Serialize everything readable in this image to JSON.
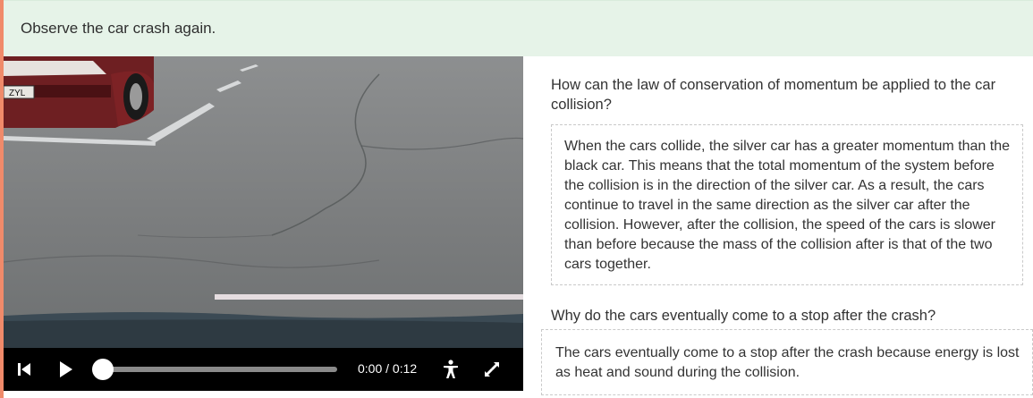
{
  "instruction": {
    "text": "Observe the car crash again."
  },
  "video": {
    "plate_text": "ZYL",
    "time_display": "0:00 / 0:12",
    "progress": 0.0,
    "controls": {
      "skip_back_icon": "skip-back-icon",
      "play_icon": "play-icon",
      "accessibility_icon": "accessibility-icon",
      "fullscreen_icon": "expand-icon"
    }
  },
  "questions": [
    {
      "question": "How can the law of conservation of momentum be applied to the car collision?",
      "answer": "When the cars collide, the silver car has a greater momentum than the black car. This means that the total momentum of the system before the collision is in the direction of the silver car.  As a result, the cars continue to travel in the same direction as the silver car after the collision. However, after the collision, the speed of the cars is slower than before because the mass of the collision after is that of the two cars together."
    },
    {
      "question": "Why do the cars eventually come to a stop after the crash?",
      "answer": "The cars eventually come to a stop after the crash because energy is lost as heat and sound during the collision."
    }
  ],
  "colors": {
    "accent": "#f08a6a",
    "banner_bg": "#e6f3e8",
    "controls_bg": "#000000"
  }
}
